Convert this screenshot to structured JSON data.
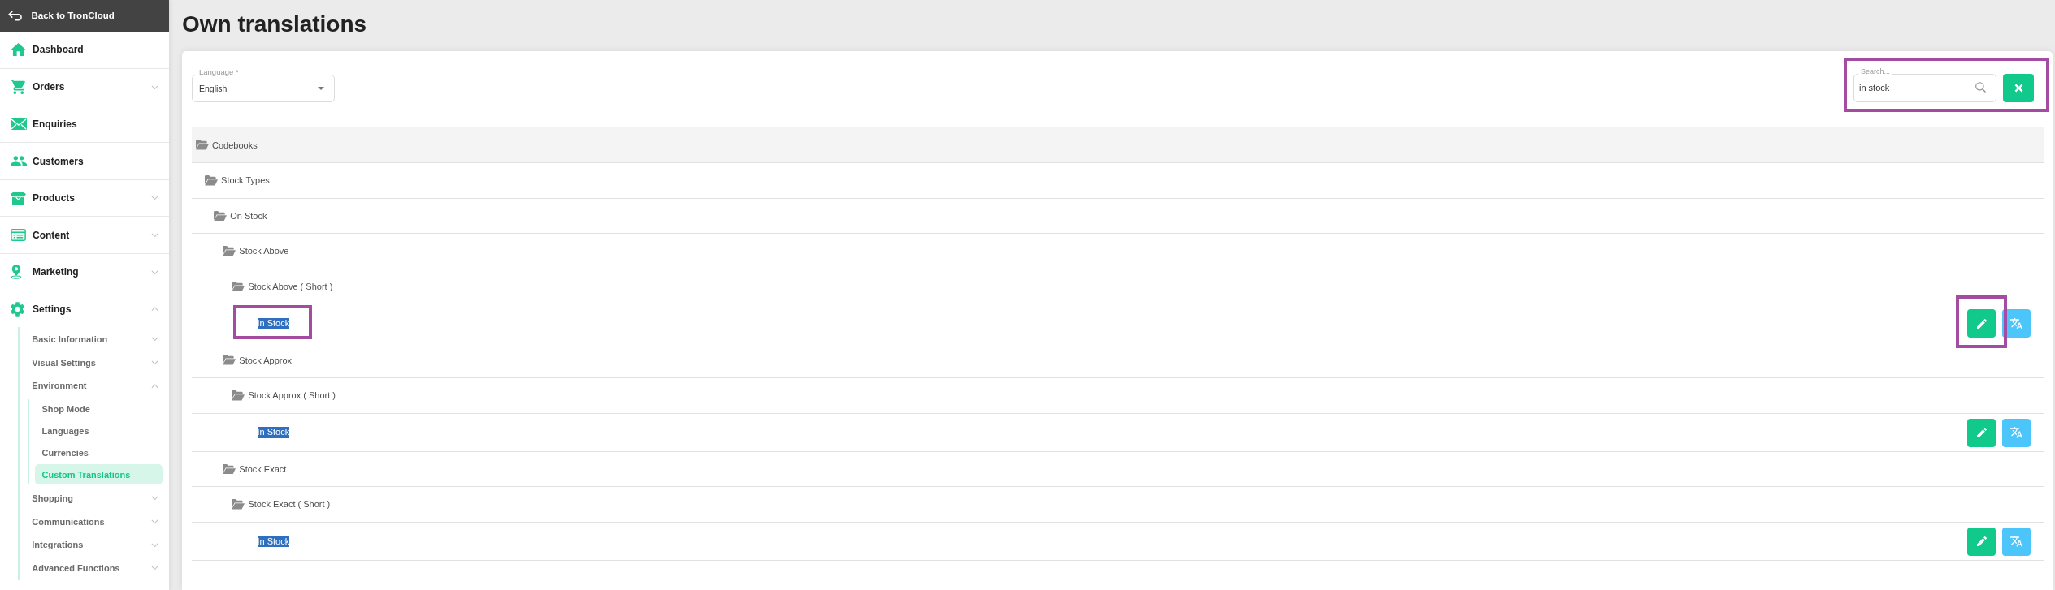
{
  "sidebar": {
    "back_link": {
      "label": "Back to TronCloud"
    },
    "items": [
      {
        "label": "Dashboard",
        "kind": "link",
        "selected": false
      },
      {
        "label": "Orders",
        "kind": "group",
        "expanded": false,
        "selected": false
      },
      {
        "label": "Enquiries",
        "kind": "link",
        "selected": false
      },
      {
        "label": "Customers",
        "kind": "link",
        "selected": false
      },
      {
        "label": "Products",
        "kind": "group",
        "expanded": false,
        "selected": false
      },
      {
        "label": "Content",
        "kind": "group",
        "expanded": false,
        "selected": false
      },
      {
        "label": "Marketing",
        "kind": "group",
        "expanded": false,
        "selected": false
      },
      {
        "label": "Settings",
        "kind": "group",
        "expanded": true,
        "selected": false,
        "children": [
          {
            "label": "Basic Information",
            "kind": "group",
            "expanded": false,
            "selected": false
          },
          {
            "label": "Visual Settings",
            "kind": "group",
            "expanded": false,
            "selected": false
          },
          {
            "label": "Environment",
            "kind": "group",
            "expanded": true,
            "selected": false,
            "children": [
              {
                "label": "Shop Mode",
                "kind": "link",
                "selected": false
              },
              {
                "label": "Languages",
                "kind": "link",
                "selected": false
              },
              {
                "label": "Currencies",
                "kind": "link",
                "selected": false
              },
              {
                "label": "Custom Translations",
                "kind": "link",
                "selected": true
              }
            ]
          },
          {
            "label": "Shopping",
            "kind": "group",
            "expanded": false,
            "selected": false
          },
          {
            "label": "Communications",
            "kind": "group",
            "expanded": false,
            "selected": false
          },
          {
            "label": "Integrations",
            "kind": "group",
            "expanded": false,
            "selected": false
          },
          {
            "label": "Advanced Functions",
            "kind": "group",
            "expanded": false,
            "selected": false
          }
        ]
      }
    ]
  },
  "page": {
    "title": "Own translations"
  },
  "filters": {
    "language_select": {
      "label": "Language *",
      "value": "English"
    },
    "search": {
      "label": "Search...",
      "value": "in stock",
      "highlighted": true
    }
  },
  "tree": [
    {
      "label": "Codebooks",
      "kind": "folder",
      "expanded": true,
      "children": [
        {
          "label": "Stock Types",
          "kind": "folder",
          "expanded": true,
          "children": [
            {
              "label": "On Stock",
              "kind": "folder",
              "expanded": true,
              "children": [
                {
                  "label": "Stock Above",
                  "kind": "folder",
                  "expanded": true,
                  "children": [
                    {
                      "label": "Stock Above ( Short )",
                      "kind": "folder",
                      "expanded": true,
                      "children": [
                        {
                          "label": "In Stock",
                          "kind": "entry",
                          "text_selected": true,
                          "highlighted": true,
                          "actions": [
                            {
                              "kind": "edit",
                              "highlighted": true
                            },
                            {
                              "kind": "translate",
                              "highlighted": false
                            }
                          ]
                        }
                      ]
                    }
                  ]
                },
                {
                  "label": "Stock Approx",
                  "kind": "folder",
                  "expanded": true,
                  "children": [
                    {
                      "label": "Stock Approx ( Short )",
                      "kind": "folder",
                      "expanded": true,
                      "children": [
                        {
                          "label": "In Stock",
                          "kind": "entry",
                          "text_selected": true,
                          "highlighted": false,
                          "actions": [
                            {
                              "kind": "edit",
                              "highlighted": false
                            },
                            {
                              "kind": "translate",
                              "highlighted": false
                            }
                          ]
                        }
                      ]
                    }
                  ]
                },
                {
                  "label": "Stock Exact",
                  "kind": "folder",
                  "expanded": true,
                  "children": [
                    {
                      "label": "Stock Exact ( Short )",
                      "kind": "folder",
                      "expanded": true,
                      "children": [
                        {
                          "label": "In Stock",
                          "kind": "entry",
                          "text_selected": true,
                          "highlighted": false,
                          "actions": [
                            {
                              "kind": "edit",
                              "highlighted": false
                            },
                            {
                              "kind": "translate",
                              "highlighted": false
                            }
                          ]
                        }
                      ]
                    }
                  ]
                }
              ]
            }
          ]
        }
      ]
    }
  ]
}
